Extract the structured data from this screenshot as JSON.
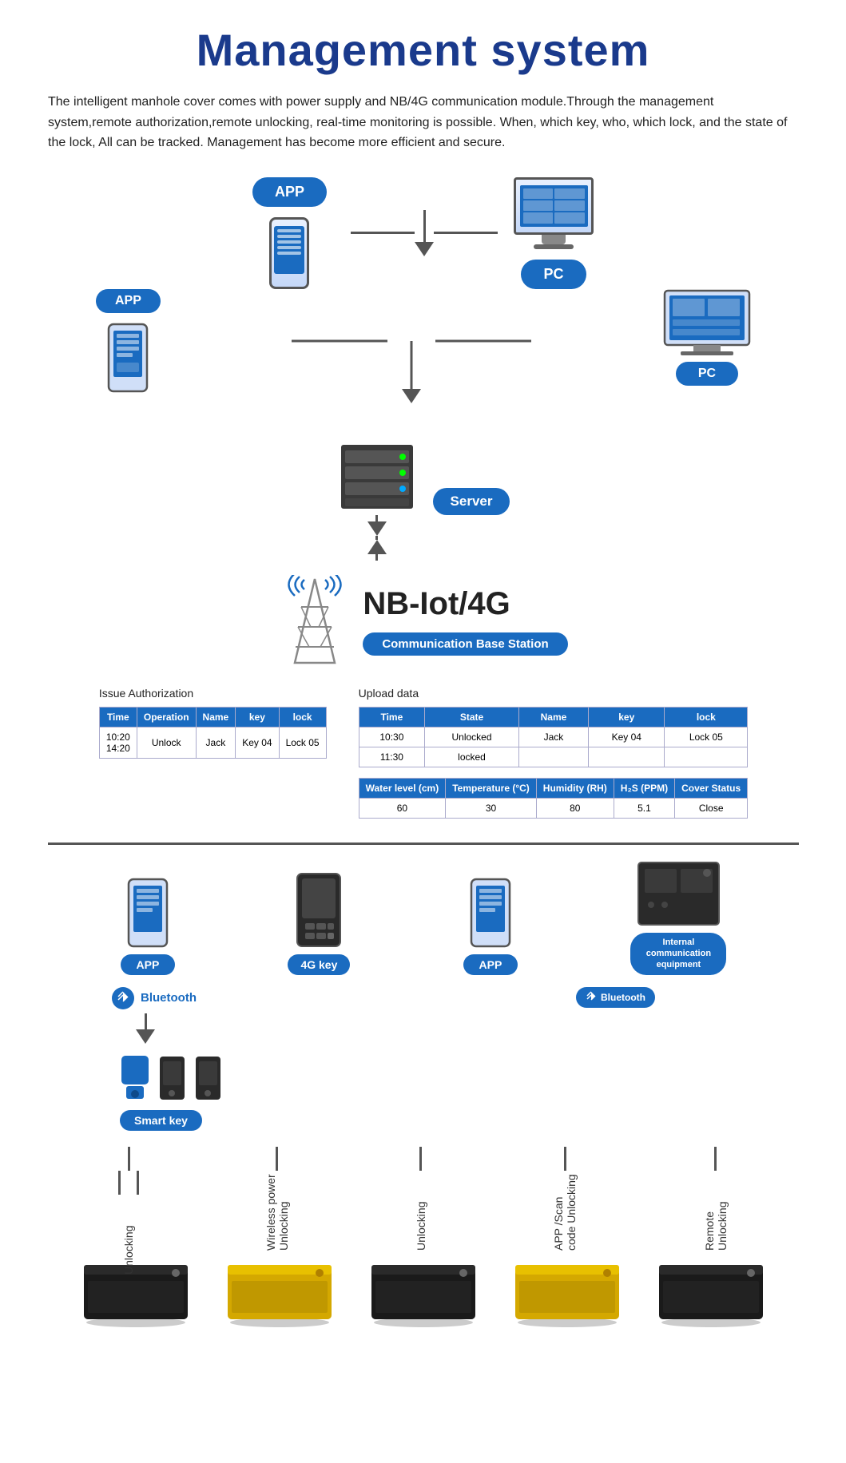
{
  "page": {
    "title": "Management system",
    "intro": "The intelligent manhole cover comes with power supply and NB/4G communication module.Through the management system,remote authorization,remote unlocking, real-time monitoring is possible.\nWhen, which key, who, which lock, and the state of the lock,  All can be tracked. Management has become more efficient and secure."
  },
  "diagram": {
    "app_label": "APP",
    "pc_label": "PC",
    "server_label": "Server",
    "nb_iot_title": "NB-Iot/4G",
    "comm_base": "Communication Base Station",
    "issue_auth_title": "Issue Authorization",
    "upload_data_title": "Upload data",
    "issue_table": {
      "headers": [
        "Time",
        "Operation",
        "Name",
        "key",
        "lock"
      ],
      "rows": [
        [
          "10:20\n14:20",
          "Unlock",
          "Jack",
          "Key 04",
          "Lock 05"
        ]
      ]
    },
    "upload_table1": {
      "headers": [
        "Time",
        "State",
        "Name",
        "key",
        "lock"
      ],
      "rows": [
        [
          "10:30",
          "Unlocked",
          "Jack",
          "Key 04",
          "Lock 05"
        ],
        [
          "11:30",
          "locked",
          "",
          "",
          ""
        ]
      ]
    },
    "upload_table2": {
      "headers": [
        "Water level (cm)",
        "Temperature (°C)",
        "Humidity (RH)",
        "H₂S (PPM)",
        "Cover Status"
      ],
      "rows": [
        [
          "60",
          "30",
          "80",
          "5.1",
          "Close"
        ]
      ]
    },
    "bottom_devices": [
      {
        "label": "APP",
        "type": "phone"
      },
      {
        "label": "4G key",
        "type": "key4g"
      },
      {
        "label": "APP",
        "type": "phone"
      },
      {
        "label": "Internal communication equipment",
        "type": "internal"
      }
    ],
    "bluetooth_label": "Bluetooth",
    "smart_key_label": "Smart key",
    "vertical_labels": [
      "Unlocking",
      "Wireless power Unlocking",
      "Unlocking",
      "APP /Scan code Unlocking",
      "Remote Unlocking"
    ],
    "bt_section_label": "Bluetooth"
  }
}
